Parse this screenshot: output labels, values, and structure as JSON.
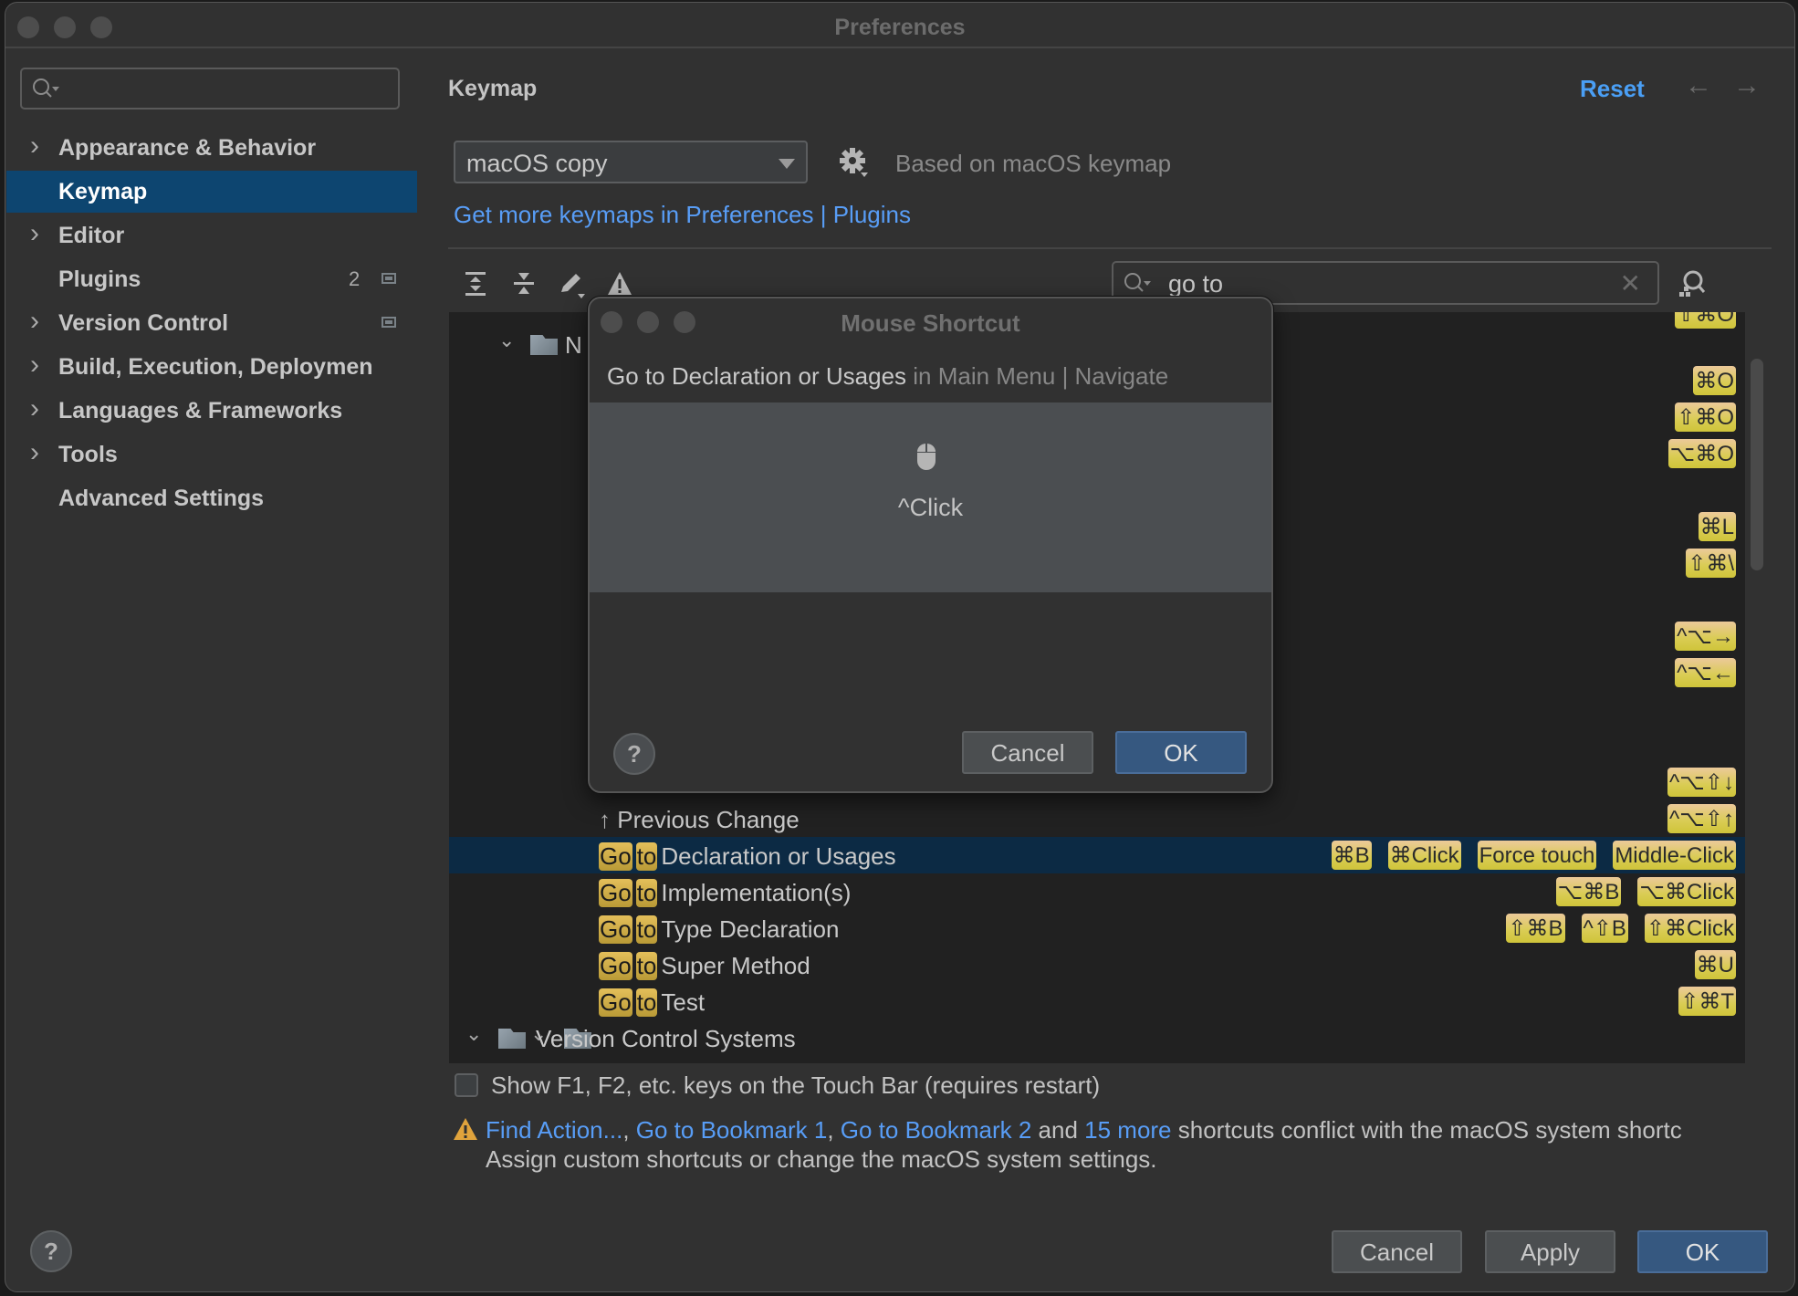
{
  "window": {
    "title": "Preferences"
  },
  "sidebar": {
    "search_placeholder": "",
    "items": [
      {
        "label": "Appearance & Behavior",
        "expandable": true
      },
      {
        "label": "Keymap",
        "expandable": false,
        "selected": true
      },
      {
        "label": "Editor",
        "expandable": true
      },
      {
        "label": "Plugins",
        "expandable": false,
        "count": "2",
        "project_icon": true
      },
      {
        "label": "Version Control",
        "expandable": true,
        "project_icon": true
      },
      {
        "label": "Build, Execution, Deploymen",
        "expandable": true
      },
      {
        "label": "Languages & Frameworks",
        "expandable": true
      },
      {
        "label": "Tools",
        "expandable": true
      },
      {
        "label": "Advanced Settings",
        "expandable": false
      }
    ]
  },
  "main": {
    "header": "Keymap",
    "reset_label": "Reset",
    "keymap_select": "macOS copy",
    "based_on": "Based on macOS keymap",
    "more_keymaps_link": "Get more keymaps in Preferences | Plugins",
    "search_value": "go to",
    "tree": {
      "group_1_label": "N",
      "top_partial_badge": "⇧⌘O",
      "badge_rows": [
        [
          "⌘O"
        ],
        [
          "⇧⌘O"
        ],
        [
          "⌥⌘O"
        ],
        [],
        [
          "⌘L"
        ],
        [
          "⇧⌘\\"
        ],
        [],
        [
          "^⌥→"
        ],
        [
          "^⌥←"
        ],
        [],
        [],
        [
          "^⌥⇧↓"
        ]
      ],
      "rows": [
        {
          "icon": "up-arrow",
          "label": "Previous Change",
          "shortcuts": [
            "^⌥⇧↑"
          ]
        },
        {
          "prefix": [
            "Go",
            "to"
          ],
          "label": "Declaration or Usages",
          "selected": true,
          "shortcuts": [
            "⌘B",
            "⌘Click",
            "Force touch",
            "Middle-Click"
          ]
        },
        {
          "prefix": [
            "Go",
            "to"
          ],
          "label": "Implementation(s)",
          "shortcuts": [
            "⌥⌘B",
            "⌥⌘Click"
          ]
        },
        {
          "prefix": [
            "Go",
            "to"
          ],
          "label": "Type Declaration",
          "shortcuts": [
            "⇧⌘B",
            "^⇧B",
            "⇧⌘Click"
          ]
        },
        {
          "prefix": [
            "Go",
            "to"
          ],
          "label": "Super Method",
          "shortcuts": [
            "⌘U"
          ]
        },
        {
          "prefix": [
            "Go",
            "to"
          ],
          "label": "Test",
          "shortcuts": [
            "⇧⌘T"
          ]
        }
      ],
      "vcs_group_label": "Version Control Systems"
    },
    "touchbar_checkbox": {
      "label": "Show F1, F2, etc. keys on the Touch Bar (requires restart)",
      "checked": false
    },
    "conflict": {
      "links": [
        "Find Action...",
        "Go to Bookmark 1",
        "Go to Bookmark 2"
      ],
      "and_text": " and ",
      "more_link": "15 more",
      "rest": " shortcuts conflict with the macOS system shortc",
      "line2": "Assign custom shortcuts or change the macOS system settings."
    }
  },
  "footer": {
    "cancel": "Cancel",
    "apply": "Apply",
    "ok": "OK",
    "help": "?"
  },
  "dialog": {
    "title": "Mouse Shortcut",
    "action": "Go to Declaration or Usages",
    "location": " in Main Menu | Navigate",
    "shortcut": "^Click",
    "cancel": "Cancel",
    "ok": "OK",
    "help": "?"
  },
  "colors": {
    "accent_link": "#589df6",
    "selection": "#0d4570",
    "primary_button": "#365880",
    "badge_top": "#ecc99a",
    "badge_bottom": "#cfc43a"
  }
}
